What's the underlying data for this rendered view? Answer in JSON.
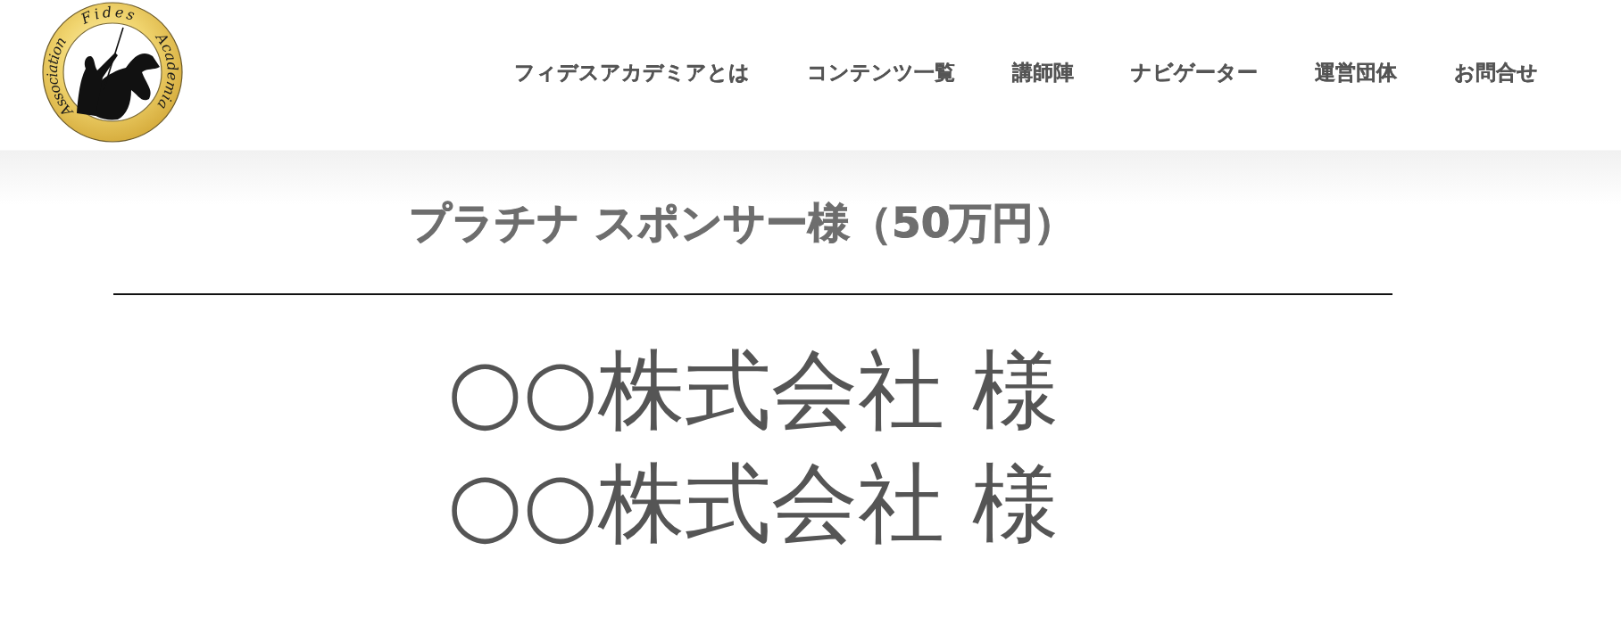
{
  "logo": {
    "words": [
      "Association",
      "Fides",
      "Academia"
    ]
  },
  "nav": {
    "items": [
      {
        "label": "フィデスアカデミアとは"
      },
      {
        "label": "コンテンツ一覧"
      },
      {
        "label": "講師陣"
      },
      {
        "label": "ナビゲーター"
      },
      {
        "label": "運営団体"
      },
      {
        "label": "お問合せ"
      }
    ]
  },
  "section": {
    "heading": "プラチナ スポンサー様（50万円）",
    "sponsors": [
      "○○株式会社 様",
      "○○株式会社 様"
    ]
  }
}
